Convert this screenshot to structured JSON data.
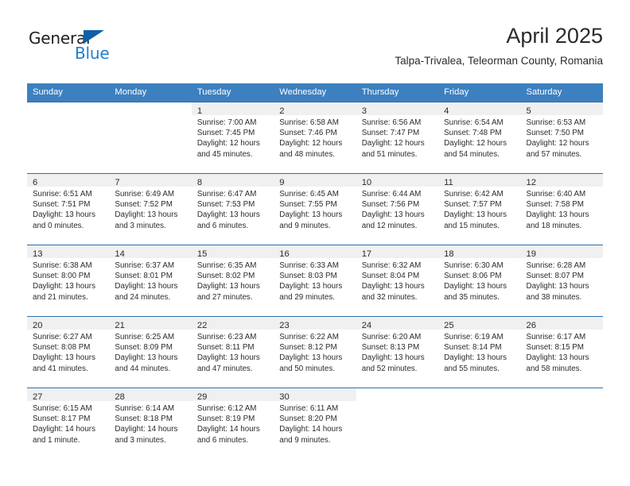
{
  "logo": {
    "word1": "General",
    "word2": "Blue",
    "triangle_color": "#1060a8",
    "word2_color": "#1f7fd0"
  },
  "header": {
    "title": "April 2025",
    "subtitle": "Talpa-Trivalea, Teleorman County, Romania"
  },
  "theme": {
    "header_bg": "#3d80bf",
    "row_divider": "#2f6fae",
    "daynum_band": "#f0f0f0",
    "text": "#2b2b2b"
  },
  "weekday_headers": [
    "Sunday",
    "Monday",
    "Tuesday",
    "Wednesday",
    "Thursday",
    "Friday",
    "Saturday"
  ],
  "weeks": [
    [
      {
        "day": "",
        "sunrise": "",
        "sunset": "",
        "daylight1": "",
        "daylight2": ""
      },
      {
        "day": "",
        "sunrise": "",
        "sunset": "",
        "daylight1": "",
        "daylight2": ""
      },
      {
        "day": "1",
        "sunrise": "Sunrise: 7:00 AM",
        "sunset": "Sunset: 7:45 PM",
        "daylight1": "Daylight: 12 hours",
        "daylight2": "and 45 minutes."
      },
      {
        "day": "2",
        "sunrise": "Sunrise: 6:58 AM",
        "sunset": "Sunset: 7:46 PM",
        "daylight1": "Daylight: 12 hours",
        "daylight2": "and 48 minutes."
      },
      {
        "day": "3",
        "sunrise": "Sunrise: 6:56 AM",
        "sunset": "Sunset: 7:47 PM",
        "daylight1": "Daylight: 12 hours",
        "daylight2": "and 51 minutes."
      },
      {
        "day": "4",
        "sunrise": "Sunrise: 6:54 AM",
        "sunset": "Sunset: 7:48 PM",
        "daylight1": "Daylight: 12 hours",
        "daylight2": "and 54 minutes."
      },
      {
        "day": "5",
        "sunrise": "Sunrise: 6:53 AM",
        "sunset": "Sunset: 7:50 PM",
        "daylight1": "Daylight: 12 hours",
        "daylight2": "and 57 minutes."
      }
    ],
    [
      {
        "day": "6",
        "sunrise": "Sunrise: 6:51 AM",
        "sunset": "Sunset: 7:51 PM",
        "daylight1": "Daylight: 13 hours",
        "daylight2": "and 0 minutes."
      },
      {
        "day": "7",
        "sunrise": "Sunrise: 6:49 AM",
        "sunset": "Sunset: 7:52 PM",
        "daylight1": "Daylight: 13 hours",
        "daylight2": "and 3 minutes."
      },
      {
        "day": "8",
        "sunrise": "Sunrise: 6:47 AM",
        "sunset": "Sunset: 7:53 PM",
        "daylight1": "Daylight: 13 hours",
        "daylight2": "and 6 minutes."
      },
      {
        "day": "9",
        "sunrise": "Sunrise: 6:45 AM",
        "sunset": "Sunset: 7:55 PM",
        "daylight1": "Daylight: 13 hours",
        "daylight2": "and 9 minutes."
      },
      {
        "day": "10",
        "sunrise": "Sunrise: 6:44 AM",
        "sunset": "Sunset: 7:56 PM",
        "daylight1": "Daylight: 13 hours",
        "daylight2": "and 12 minutes."
      },
      {
        "day": "11",
        "sunrise": "Sunrise: 6:42 AM",
        "sunset": "Sunset: 7:57 PM",
        "daylight1": "Daylight: 13 hours",
        "daylight2": "and 15 minutes."
      },
      {
        "day": "12",
        "sunrise": "Sunrise: 6:40 AM",
        "sunset": "Sunset: 7:58 PM",
        "daylight1": "Daylight: 13 hours",
        "daylight2": "and 18 minutes."
      }
    ],
    [
      {
        "day": "13",
        "sunrise": "Sunrise: 6:38 AM",
        "sunset": "Sunset: 8:00 PM",
        "daylight1": "Daylight: 13 hours",
        "daylight2": "and 21 minutes."
      },
      {
        "day": "14",
        "sunrise": "Sunrise: 6:37 AM",
        "sunset": "Sunset: 8:01 PM",
        "daylight1": "Daylight: 13 hours",
        "daylight2": "and 24 minutes."
      },
      {
        "day": "15",
        "sunrise": "Sunrise: 6:35 AM",
        "sunset": "Sunset: 8:02 PM",
        "daylight1": "Daylight: 13 hours",
        "daylight2": "and 27 minutes."
      },
      {
        "day": "16",
        "sunrise": "Sunrise: 6:33 AM",
        "sunset": "Sunset: 8:03 PM",
        "daylight1": "Daylight: 13 hours",
        "daylight2": "and 29 minutes."
      },
      {
        "day": "17",
        "sunrise": "Sunrise: 6:32 AM",
        "sunset": "Sunset: 8:04 PM",
        "daylight1": "Daylight: 13 hours",
        "daylight2": "and 32 minutes."
      },
      {
        "day": "18",
        "sunrise": "Sunrise: 6:30 AM",
        "sunset": "Sunset: 8:06 PM",
        "daylight1": "Daylight: 13 hours",
        "daylight2": "and 35 minutes."
      },
      {
        "day": "19",
        "sunrise": "Sunrise: 6:28 AM",
        "sunset": "Sunset: 8:07 PM",
        "daylight1": "Daylight: 13 hours",
        "daylight2": "and 38 minutes."
      }
    ],
    [
      {
        "day": "20",
        "sunrise": "Sunrise: 6:27 AM",
        "sunset": "Sunset: 8:08 PM",
        "daylight1": "Daylight: 13 hours",
        "daylight2": "and 41 minutes."
      },
      {
        "day": "21",
        "sunrise": "Sunrise: 6:25 AM",
        "sunset": "Sunset: 8:09 PM",
        "daylight1": "Daylight: 13 hours",
        "daylight2": "and 44 minutes."
      },
      {
        "day": "22",
        "sunrise": "Sunrise: 6:23 AM",
        "sunset": "Sunset: 8:11 PM",
        "daylight1": "Daylight: 13 hours",
        "daylight2": "and 47 minutes."
      },
      {
        "day": "23",
        "sunrise": "Sunrise: 6:22 AM",
        "sunset": "Sunset: 8:12 PM",
        "daylight1": "Daylight: 13 hours",
        "daylight2": "and 50 minutes."
      },
      {
        "day": "24",
        "sunrise": "Sunrise: 6:20 AM",
        "sunset": "Sunset: 8:13 PM",
        "daylight1": "Daylight: 13 hours",
        "daylight2": "and 52 minutes."
      },
      {
        "day": "25",
        "sunrise": "Sunrise: 6:19 AM",
        "sunset": "Sunset: 8:14 PM",
        "daylight1": "Daylight: 13 hours",
        "daylight2": "and 55 minutes."
      },
      {
        "day": "26",
        "sunrise": "Sunrise: 6:17 AM",
        "sunset": "Sunset: 8:15 PM",
        "daylight1": "Daylight: 13 hours",
        "daylight2": "and 58 minutes."
      }
    ],
    [
      {
        "day": "27",
        "sunrise": "Sunrise: 6:15 AM",
        "sunset": "Sunset: 8:17 PM",
        "daylight1": "Daylight: 14 hours",
        "daylight2": "and 1 minute."
      },
      {
        "day": "28",
        "sunrise": "Sunrise: 6:14 AM",
        "sunset": "Sunset: 8:18 PM",
        "daylight1": "Daylight: 14 hours",
        "daylight2": "and 3 minutes."
      },
      {
        "day": "29",
        "sunrise": "Sunrise: 6:12 AM",
        "sunset": "Sunset: 8:19 PM",
        "daylight1": "Daylight: 14 hours",
        "daylight2": "and 6 minutes."
      },
      {
        "day": "30",
        "sunrise": "Sunrise: 6:11 AM",
        "sunset": "Sunset: 8:20 PM",
        "daylight1": "Daylight: 14 hours",
        "daylight2": "and 9 minutes."
      },
      {
        "day": "",
        "sunrise": "",
        "sunset": "",
        "daylight1": "",
        "daylight2": ""
      },
      {
        "day": "",
        "sunrise": "",
        "sunset": "",
        "daylight1": "",
        "daylight2": ""
      },
      {
        "day": "",
        "sunrise": "",
        "sunset": "",
        "daylight1": "",
        "daylight2": ""
      }
    ]
  ]
}
